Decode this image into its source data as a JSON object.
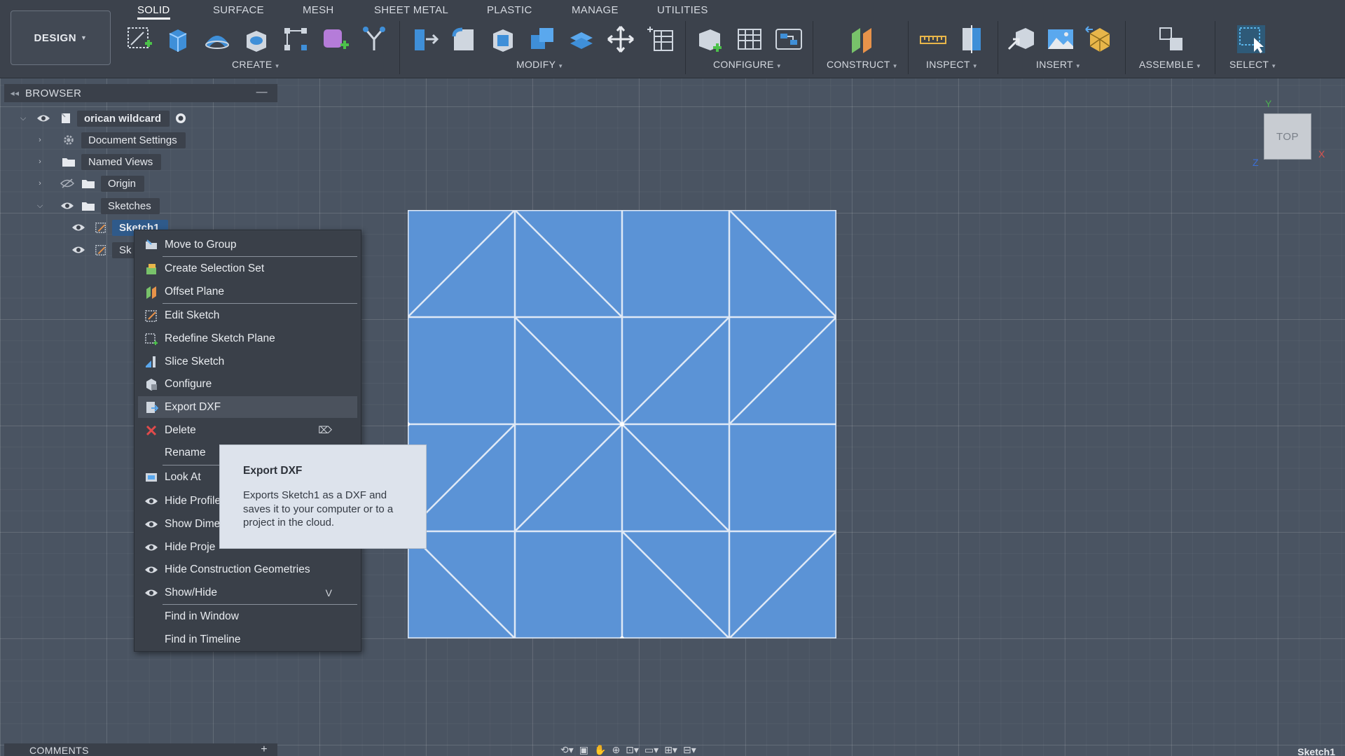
{
  "toolbar": {
    "workspace_button": "DESIGN",
    "tabs": [
      "SOLID",
      "SURFACE",
      "MESH",
      "SHEET METAL",
      "PLASTIC",
      "MANAGE",
      "UTILITIES"
    ],
    "groups": {
      "create": "CREATE",
      "modify": "MODIFY",
      "configure": "CONFIGURE",
      "construct": "CONSTRUCT",
      "inspect": "INSPECT",
      "insert": "INSERT",
      "assemble": "ASSEMBLE",
      "select": "SELECT"
    }
  },
  "browser": {
    "title": "BROWSER",
    "root": "orican wildcard",
    "items": {
      "document_settings": "Document Settings",
      "named_views": "Named Views",
      "origin": "Origin",
      "sketches": "Sketches",
      "sketch1": "Sketch1",
      "sketch2": "Sk"
    }
  },
  "context_menu": {
    "items": [
      "Move to Group",
      "Create Selection Set",
      "Offset Plane",
      "Edit Sketch",
      "Redefine Sketch Plane",
      "Slice Sketch",
      "Configure",
      "Export DXF",
      "Delete",
      "Rename",
      "Look At",
      "Hide Profile",
      "Show Dime",
      "Hide Proje",
      "Hide Construction Geometries",
      "Show/Hide",
      "Find in Window",
      "Find in Timeline"
    ],
    "shortcuts": {
      "show_hide": "V"
    }
  },
  "tooltip": {
    "title": "Export DXF",
    "body": "Exports Sketch1 as a DXF and saves it to your computer or to a project in the cloud."
  },
  "viewcube": {
    "face": "TOP",
    "axis_y": "Y",
    "axis_x": "X",
    "axis_z": "Z"
  },
  "bottom": {
    "comments": "COMMENTS",
    "status": "Sketch1"
  },
  "colors": {
    "toolbar_bg": "#3c424c",
    "canvas_bg": "#4a5462",
    "sketch_fill": "#5b93d6",
    "sketch_line": "#dfe9f6",
    "menu_bg": "#3a4049",
    "tooltip_bg": "#dde3ec"
  }
}
